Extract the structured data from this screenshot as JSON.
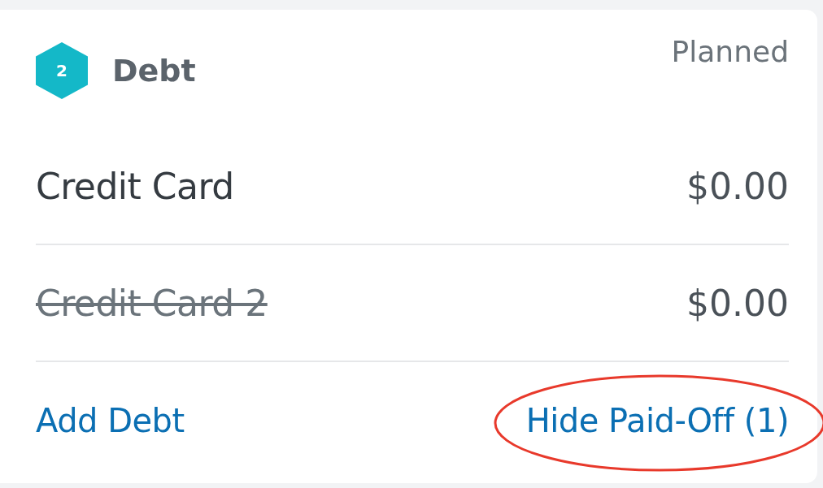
{
  "category": {
    "number": "2",
    "title": "Debt",
    "column_label": "Planned"
  },
  "items": [
    {
      "name": "Credit Card",
      "amount": "$0.00",
      "paid_off": false
    },
    {
      "name": "Credit Card 2",
      "amount": "$0.00",
      "paid_off": true
    }
  ],
  "footer": {
    "add_link": "Add Debt",
    "toggle_link": "Hide Paid-Off (1)",
    "toggle_circled": true
  }
}
